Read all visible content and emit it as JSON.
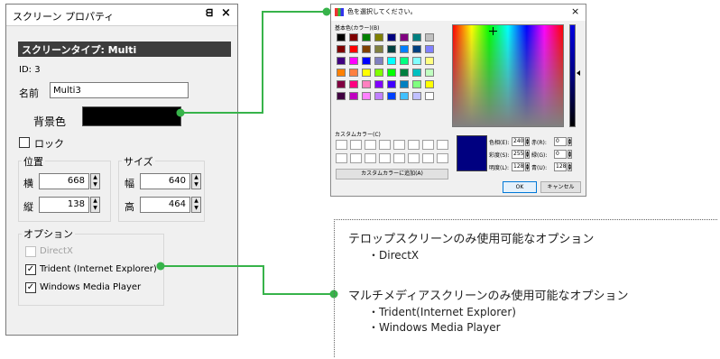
{
  "panel": {
    "title": "スクリーン プロパティ",
    "pin_glyph": "ᗺ",
    "close_glyph": "×",
    "type_header": "スクリーンタイプ: Multi",
    "id_text": "ID: 3",
    "name_label": "名前",
    "name_value": "Multi3",
    "background_label": "背景色",
    "background_color": "#000000",
    "lock_label": "ロック",
    "position": {
      "title": "位置",
      "x_label": "横",
      "x_value": "668",
      "y_label": "縦",
      "y_value": "138"
    },
    "size": {
      "title": "サイズ",
      "w_label": "幅",
      "w_value": "640",
      "h_label": "高",
      "h_value": "464"
    },
    "options": {
      "title": "オプション",
      "directx": "DirectX",
      "trident": "Trident (Internet Explorer)",
      "wmp": "Windows Media Player"
    }
  },
  "color_dialog": {
    "title": "色を選択してください。",
    "close_glyph": "×",
    "basic_colors_label": "基本色(カラー)(B)",
    "basic_colors": [
      "#000000",
      "#800000",
      "#008000",
      "#808000",
      "#000080",
      "#800080",
      "#008080",
      "#c0c0c0",
      "#800000",
      "#ff0000",
      "#804000",
      "#808040",
      "#004040",
      "#0080ff",
      "#004080",
      "#8080ff",
      "#400080",
      "#ff00ff",
      "#0000ff",
      "#8080c0",
      "#00ffff",
      "#00ff80",
      "#80ffff",
      "#ffff80",
      "#ff8000",
      "#ff8040",
      "#ffff00",
      "#80ff00",
      "#00ff00",
      "#008040",
      "#00c0c0",
      "#c0ffc0",
      "#800040",
      "#ff0080",
      "#ff80c0",
      "#8000ff",
      "#4000ff",
      "#0080c0",
      "#80ff80",
      "#ffff00",
      "#400040",
      "#c000c0",
      "#ff80ff",
      "#c080ff",
      "#0040ff",
      "#40c0ff",
      "#c0c0ff",
      "#ffffff"
    ],
    "custom_colors_label": "カスタムカラー(C)",
    "add_custom_button": "カスタムカラーに追加(A)",
    "hue_label": "色相(E):",
    "hue_value": "240",
    "sat_label": "彩度(S):",
    "sat_value": "255",
    "lum_label": "明度(L):",
    "lum_value": "128",
    "red_label": "赤(R):",
    "red_value": "0",
    "green_label": "緑(G):",
    "green_value": "0",
    "blue_label": "青(U):",
    "blue_value": "128",
    "ok_button": "OK",
    "cancel_button": "キャンセル",
    "selected_color": "#000080"
  },
  "annotations": {
    "telop_heading": "テロップスクリーンのみ使用可能なオプション",
    "telop_item": "・DirectX",
    "multimedia_heading": "マルチメディアスクリーンのみ使用可能なオプション",
    "multimedia_items": [
      "・Trident(Internet Explorer)",
      "・Windows Media Player"
    ],
    "accent_color": "#37b34a"
  }
}
